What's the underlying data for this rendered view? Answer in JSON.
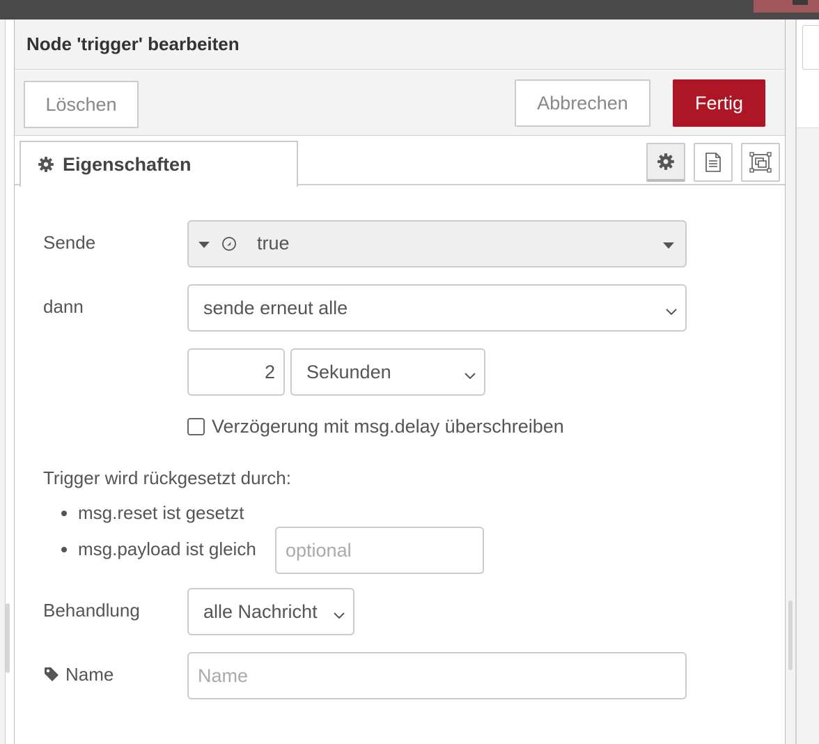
{
  "dialog": {
    "title": "Node 'trigger' bearbeiten",
    "buttons": {
      "delete": "Löschen",
      "cancel": "Abbrechen",
      "done": "Fertig"
    },
    "colors": {
      "done_button": "#ad1625",
      "topbar_accent": "#a0585b"
    }
  },
  "tabs": {
    "properties": {
      "label": "Eigenschaften",
      "icon": "gear-icon"
    },
    "side_buttons": [
      {
        "icon": "gear-icon",
        "selected": true
      },
      {
        "icon": "document-icon",
        "selected": false
      },
      {
        "icon": "appearance-icon",
        "selected": false
      }
    ]
  },
  "form": {
    "send": {
      "label": "Sende",
      "type_icon": "boolean-icon",
      "value": "true"
    },
    "then": {
      "label": "dann",
      "value": "sende erneut alle"
    },
    "interval": {
      "value": "2",
      "unit": "Sekunden"
    },
    "override_delay": {
      "label": "Verzögerung mit msg.delay überschreiben",
      "checked": false
    },
    "reset": {
      "heading": "Trigger wird rückgesetzt durch:",
      "items": [
        "msg.reset ist gesetzt",
        "msg.payload ist gleich"
      ],
      "payload_placeholder": "optional"
    },
    "handling": {
      "label": "Behandlung",
      "value": "alle Nachricht"
    },
    "name": {
      "label": "Name",
      "icon": "tag-icon",
      "placeholder": "Name"
    }
  }
}
